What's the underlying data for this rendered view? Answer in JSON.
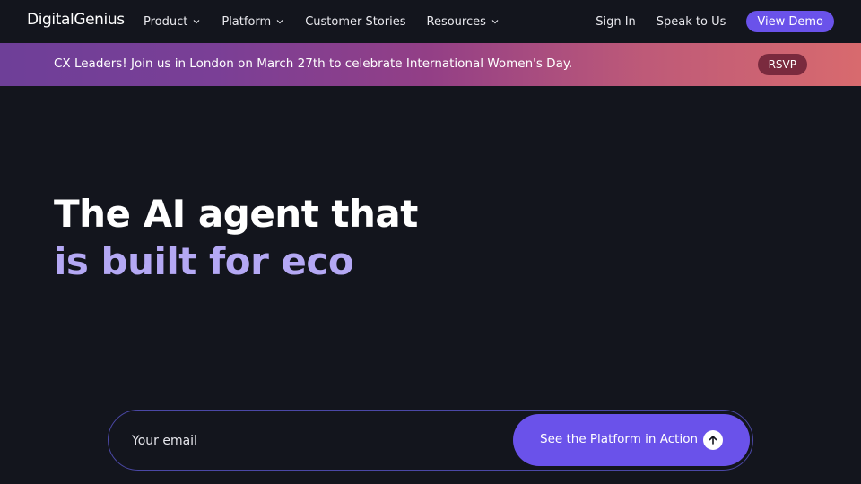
{
  "brand": {
    "logo_text": "DigitalGenius"
  },
  "nav": {
    "items": [
      {
        "label": "Product",
        "has_dropdown": true
      },
      {
        "label": "Platform",
        "has_dropdown": true
      },
      {
        "label": "Customer Stories",
        "has_dropdown": false
      },
      {
        "label": "Resources",
        "has_dropdown": true
      }
    ],
    "sign_in": "Sign In",
    "speak_to_us": "Speak to Us",
    "view_demo": "View Demo"
  },
  "banner": {
    "text": "CX Leaders! Join us in London on March 27th to celebrate International Women's Day.",
    "cta": "RSVP"
  },
  "hero": {
    "line1": "The AI agent that",
    "line2": "is built for eco"
  },
  "form": {
    "email_placeholder": "Your email",
    "email_value": "",
    "submit_label": "See the Platform in Action"
  },
  "icons": {
    "dropdown": "chevron-down-icon",
    "submit": "arrow-up-icon"
  },
  "colors": {
    "background": "#13151d",
    "accent": "#6a52ea",
    "hero_highlight": "#b4a8f4",
    "rsvp_bg": "#7a2a3e"
  }
}
